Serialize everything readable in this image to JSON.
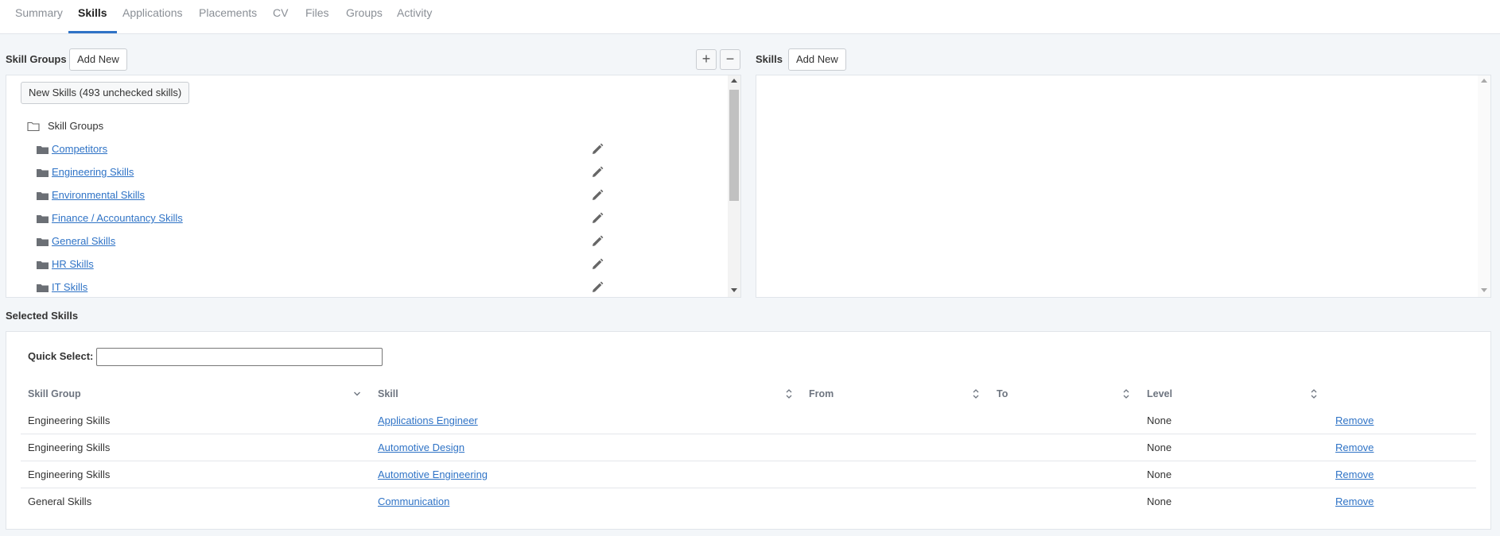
{
  "tabs": [
    {
      "label": "Summary"
    },
    {
      "label": "Skills"
    },
    {
      "label": "Applications"
    },
    {
      "label": "Placements"
    },
    {
      "label": "CV"
    },
    {
      "label": "Files"
    },
    {
      "label": "Groups"
    },
    {
      "label": "Activity"
    }
  ],
  "skill_groups": {
    "title": "Skill Groups",
    "add_new_label": "Add New",
    "expand_label": "+",
    "collapse_label": "−",
    "new_skills_label": "New Skills (493 unchecked skills)",
    "root_label": "Skill Groups",
    "items": [
      {
        "label": "Competitors"
      },
      {
        "label": "Engineering Skills"
      },
      {
        "label": "Environmental Skills"
      },
      {
        "label": "Finance / Accountancy Skills"
      },
      {
        "label": "General Skills"
      },
      {
        "label": "HR Skills"
      },
      {
        "label": "IT Skills"
      }
    ]
  },
  "skills": {
    "title": "Skills",
    "add_new_label": "Add New"
  },
  "selected_skills": {
    "title": "Selected Skills",
    "quick_select_label": "Quick Select:",
    "quick_select_value": "",
    "columns": [
      "Skill Group",
      "Skill",
      "From",
      "To",
      "Level"
    ],
    "rows": [
      {
        "group": "Engineering Skills",
        "skill": "Applications Engineer",
        "from": "",
        "to": "",
        "level": "None",
        "action": "Remove"
      },
      {
        "group": "Engineering Skills",
        "skill": "Automotive Design",
        "from": "",
        "to": "",
        "level": "None",
        "action": "Remove"
      },
      {
        "group": "Engineering Skills",
        "skill": "Automotive Engineering",
        "from": "",
        "to": "",
        "level": "None",
        "action": "Remove"
      },
      {
        "group": "General Skills",
        "skill": "Communication",
        "from": "",
        "to": "",
        "level": "None",
        "action": "Remove"
      }
    ]
  },
  "colors": {
    "accent": "#2f73c6",
    "background": "#f3f6f9"
  }
}
